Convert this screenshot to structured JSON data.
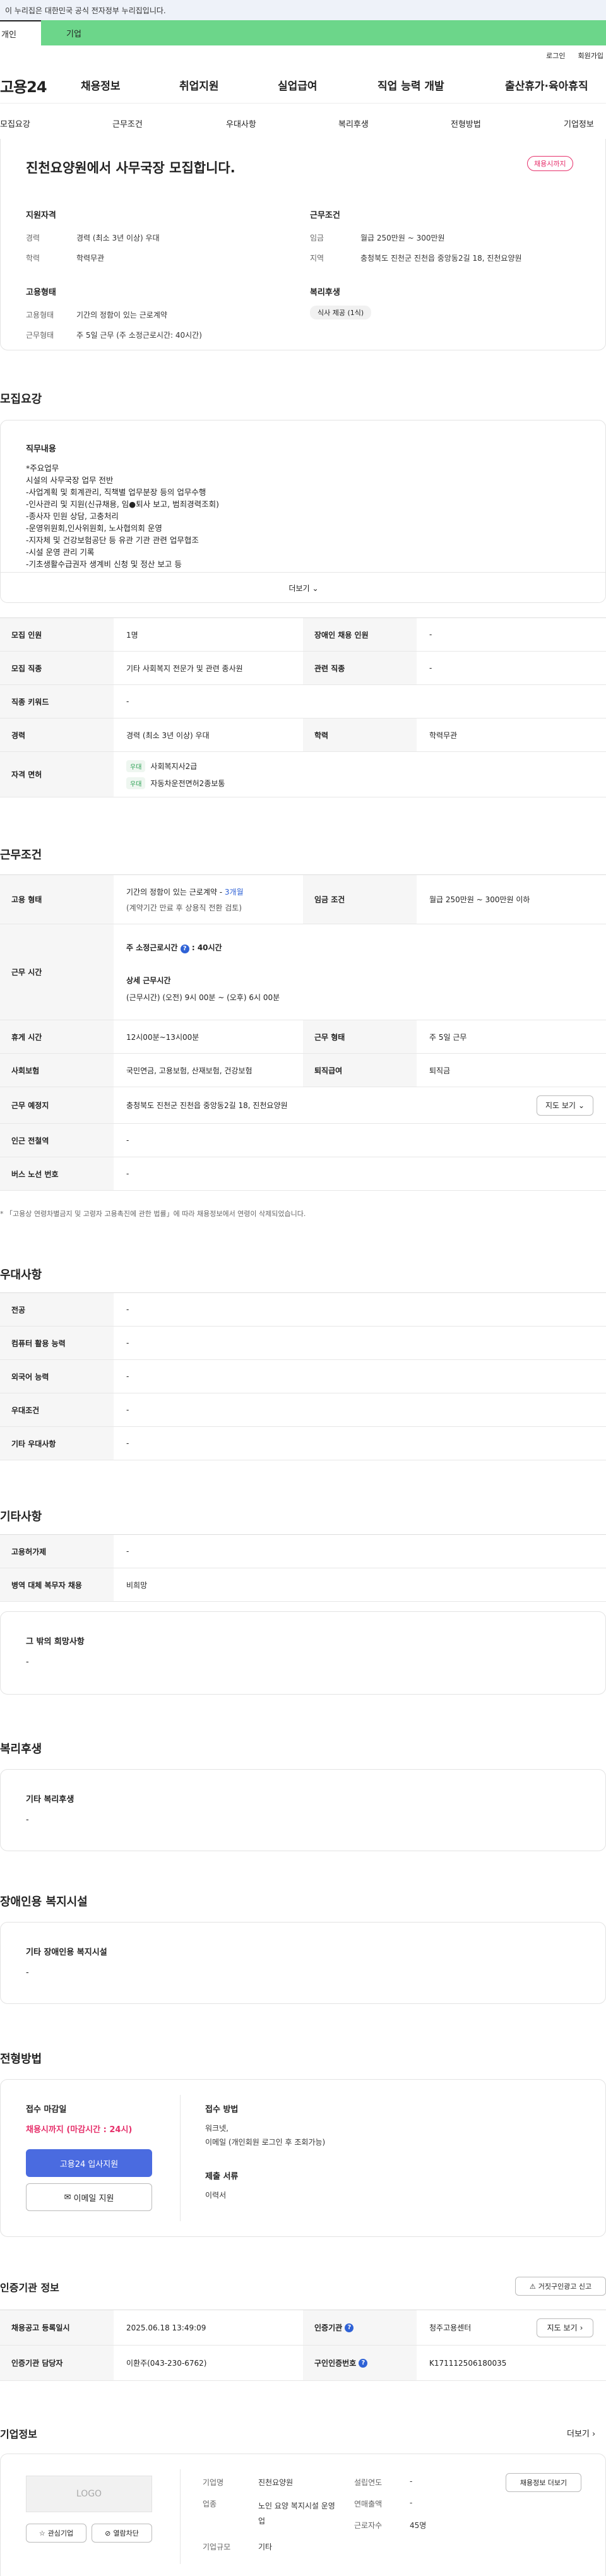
{
  "topbar": {
    "notice": "이 누리집은 대한민국 공식 전자정부 누리집입니다."
  },
  "tabs": {
    "personal": "개인",
    "company": "기업"
  },
  "util": {
    "login": "로그인",
    "signup": "회원가입"
  },
  "gnb": {
    "logo": "고용24",
    "items": [
      "채용정보",
      "취업지원",
      "실업급여",
      "직업 능력 개발",
      "출산휴가·육아휴직"
    ]
  },
  "subnav": {
    "items": [
      "모집요강",
      "근무조건",
      "우대사항",
      "복리후생",
      "전형방법",
      "기업정보"
    ]
  },
  "summary": {
    "title": "진천요양원에서 사무국장 모집합니다.",
    "status": "채용시까지",
    "qualification": {
      "heading": "지원자격",
      "career_label": "경력",
      "career": "경력 (최소 3년 이상) 우대",
      "edu_label": "학력",
      "edu": "학력무관"
    },
    "conditions": {
      "heading": "근무조건",
      "wage_label": "임금",
      "wage": "월급 250만원 ~ 300만원",
      "area_label": "지역",
      "area": "충청북도 진천군 진천읍 중앙동2길 18, 진천요양원"
    },
    "employment": {
      "heading": "고용형태",
      "type_label": "고용형태",
      "type": "기간의 정함이 있는 근로계약",
      "hours_label": "근무형태",
      "hours": "주 5일 근무 (주 소정근로시간: 40시간)"
    },
    "welfare": {
      "heading": "복리후생",
      "badge": "식사 제공 (1식)"
    }
  },
  "recruit": {
    "heading": "모집요강",
    "duty_heading": "직무내용",
    "duty_lines": [
      "*주요업무",
      "시설의 사무국장 업무 전반",
      "-사업계획 및 회계관리, 직책별 업무분장 등의 업무수행",
      "-인사관리 및 지원(신규채용, 임●퇴사 보고, 범죄경력조회)",
      "-종사자 민원 상담, 고충처리",
      "-운영위원회,인사위원회, 노사협의회 운영",
      "-지자체 및 건강보험공단 등 유관 기관 관련 업무협조",
      "-시설 운영 관리 기록",
      "-기초생활수급권자 생계비 신청 및 정산 보고 등"
    ],
    "more": "더보기",
    "rows": [
      {
        "th1": "모집 인원",
        "td1": "1명",
        "th2": "장애인 채용 인원",
        "td2": "-"
      },
      {
        "th1": "모집 직종",
        "td1": "기타 사회복지 전문가 및 관련 종사원",
        "th2": "관련 직종",
        "td2": "-"
      },
      {
        "th1": "직종 키워드",
        "td1": "-"
      },
      {
        "th1": "경력",
        "td1": "경력 (최소 3년 이상) 우대",
        "th2": "학력",
        "td2": "학력무관"
      }
    ],
    "license_th": "자격 면허",
    "licenses": [
      {
        "tag": "우대",
        "name": "사회복지사2급"
      },
      {
        "tag": "우대",
        "name": "자동차운전면허2종보통"
      }
    ]
  },
  "work": {
    "heading": "근무조건",
    "type_th": "고용 형태",
    "type_line1": "기간의 정함이 있는 근로계약 - ",
    "type_months": "3개월",
    "type_line2": "(계약기간 만료 후 상용직 전환 검토)",
    "wage_th": "임금 조건",
    "wage": "월급 250만원 ~ 300만원 이하",
    "time_th": "근무 시간",
    "time_title": "주 소정근로시간",
    "time_total": "40시간",
    "time_detail_title": "상세 근무시간",
    "time_detail": "(근무시간) (오전) 9시 00분 ~ (오후) 6시 00분",
    "break_th": "휴게 시간",
    "break": "12시00분~13시00분",
    "shape_th": "근무 형태",
    "shape": "주 5일 근무",
    "insurance_th": "사회보험",
    "insurance": "국민연금, 고용보험, 산재보험, 건강보험",
    "severance_th": "퇴직급여",
    "severance": "퇴직금",
    "place_th": "근무 예정지",
    "place": "충청북도 진천군 진천읍 중앙동2길 18, 진천요양원",
    "map": "지도 보기",
    "station_th": "인근 전철역",
    "station": "-",
    "bus_th": "버스 노선 번호",
    "bus": "-",
    "note": "* 「고용상 연령차별금지 및 고령자 고용촉진에 관한 법률」에 따라 채용정보에서 연령이 삭제되었습니다."
  },
  "prefer": {
    "heading": "우대사항",
    "rows": [
      {
        "th": "전공",
        "td": "-"
      },
      {
        "th": "컴퓨터 활용 능력",
        "td": "-"
      },
      {
        "th": "외국어 능력",
        "td": "-"
      },
      {
        "th": "우대조건",
        "td": "-"
      },
      {
        "th": "기타 우대사항",
        "td": "-"
      }
    ]
  },
  "etc": {
    "heading": "기타사항",
    "rows": [
      {
        "th": "고용허가제",
        "td": "-"
      },
      {
        "th": "병역 대체 복무자 채용",
        "td": "비희망"
      }
    ],
    "other_title": "그 밖의 희망사항",
    "other_value": "-"
  },
  "benefit": {
    "heading": "복리후생",
    "title": "기타 복리후생",
    "value": "-"
  },
  "disabled": {
    "heading": "장애인용 복지시설",
    "title": "기타 장애인용 복지시설",
    "value": "-"
  },
  "process": {
    "heading": "전형방법",
    "deadline_title": "접수 마감일",
    "deadline": "채용시까지 (마감시간 : 24시)",
    "apply_btn": "고용24 입사지원",
    "email_btn": "이메일 지원",
    "method_title": "접수 방법",
    "method1": "워크넷,",
    "method2": "이메일 (개인회원 로그인 후 조회가능)",
    "docs_title": "제출 서류",
    "docs": "이력서"
  },
  "agency": {
    "heading": "인증기관 정보",
    "report": "거짓구인광고 신고",
    "rows": [
      {
        "th1": "채용공고 등록일시",
        "td1": "2025.06.18 13:49:09",
        "th2": "인증기관",
        "td2": "청주고용센터",
        "btn": "지도 보기"
      },
      {
        "th1": "인증기관 담당자",
        "td1": "이환주(043-230-6762)",
        "th2": "구인인증번호",
        "td2": "K171112506180035"
      }
    ]
  },
  "company": {
    "heading": "기업정보",
    "more": "더보기",
    "logo": "LOGO",
    "fav": "관심기업",
    "block": "열람차단",
    "name_label": "기업명",
    "name": "진천요양원",
    "biz_label": "업종",
    "biz": "노인 요양 복지시설 운영업",
    "size_label": "기업규모",
    "size": "기타",
    "year_label": "설립연도",
    "year": "-",
    "sales_label": "연매출액",
    "sales": "-",
    "staff_label": "근로자수",
    "staff": "45명",
    "jobs_btn": "채용정보 더보기"
  }
}
